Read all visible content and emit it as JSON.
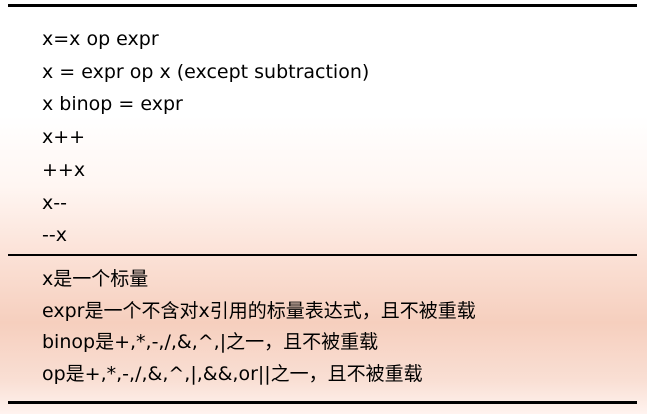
{
  "syntax_forms": [
    "x=x op expr",
    "x = expr op x (except subtraction)",
    "x binop = expr",
    "x++",
    "++x",
    "x--",
    "--x"
  ],
  "notes": [
    "x是一个标量",
    "expr是一个不含对x引用的标量表达式，且不被重载",
    "binop是+,*,-,/,&,^,|之一，且不被重载",
    "op是+,*,-,/,&,^,|,&&,or||之一，且不被重载"
  ]
}
